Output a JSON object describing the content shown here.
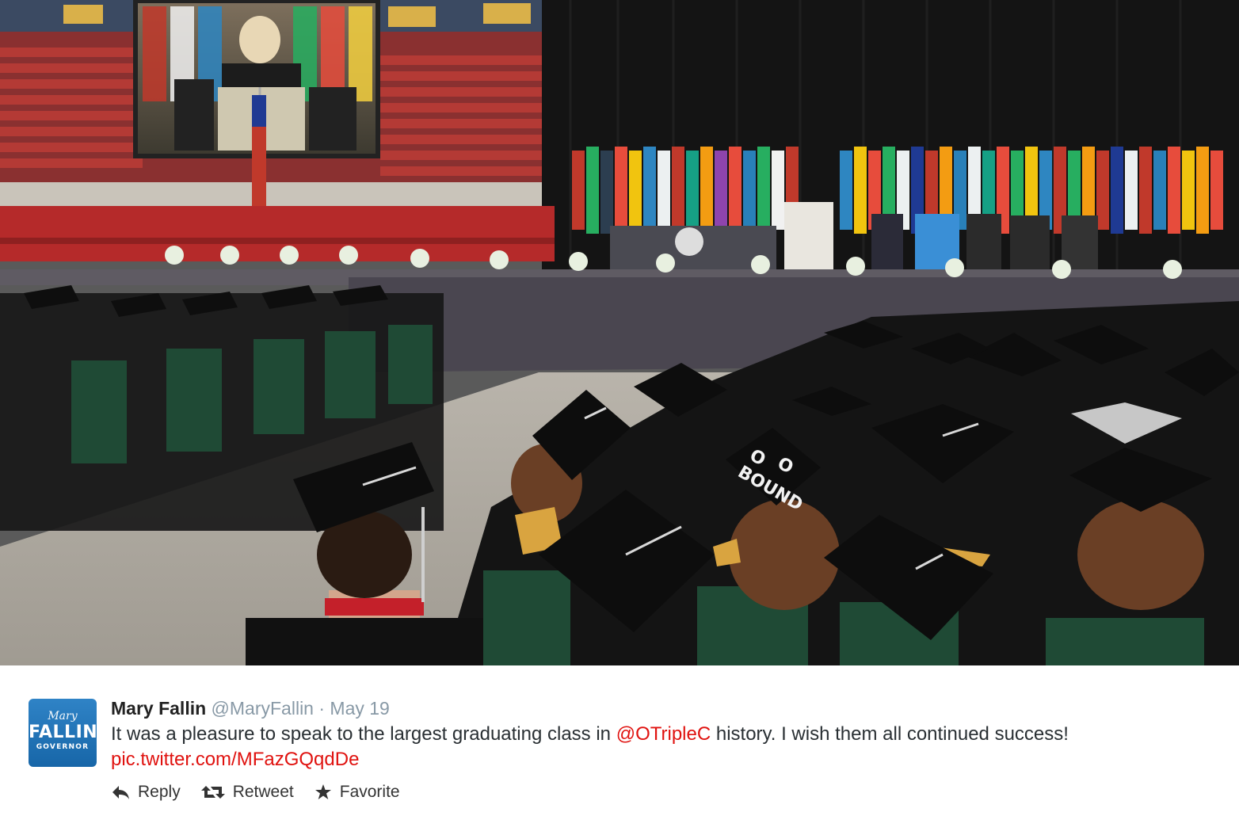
{
  "photo": {
    "description_icon": "graduation-photo",
    "cap_text": [
      "O",
      "O",
      "BOUND"
    ]
  },
  "tweet": {
    "avatar": {
      "script": "Mary",
      "name": "FALLIN",
      "title": "GOVERNOR"
    },
    "display_name": "Mary Fallin",
    "handle": "@MaryFallin",
    "separator": "·",
    "date": "May 19",
    "text_before": "It was a pleasure to speak to the largest graduating class in ",
    "mention": "@OTripleC",
    "text_after": " history. I wish them all continued success!",
    "pic_link": "pic.twitter.com/MFazGQqdDe",
    "actions": [
      {
        "label": "Reply",
        "icon": "reply-icon"
      },
      {
        "label": "Retweet",
        "icon": "retweet-icon"
      },
      {
        "label": "Favorite",
        "icon": "star-icon"
      }
    ]
  },
  "colors": {
    "link": "#e0120f",
    "meta": "#8899a6",
    "avatar": "#1f74b8"
  }
}
